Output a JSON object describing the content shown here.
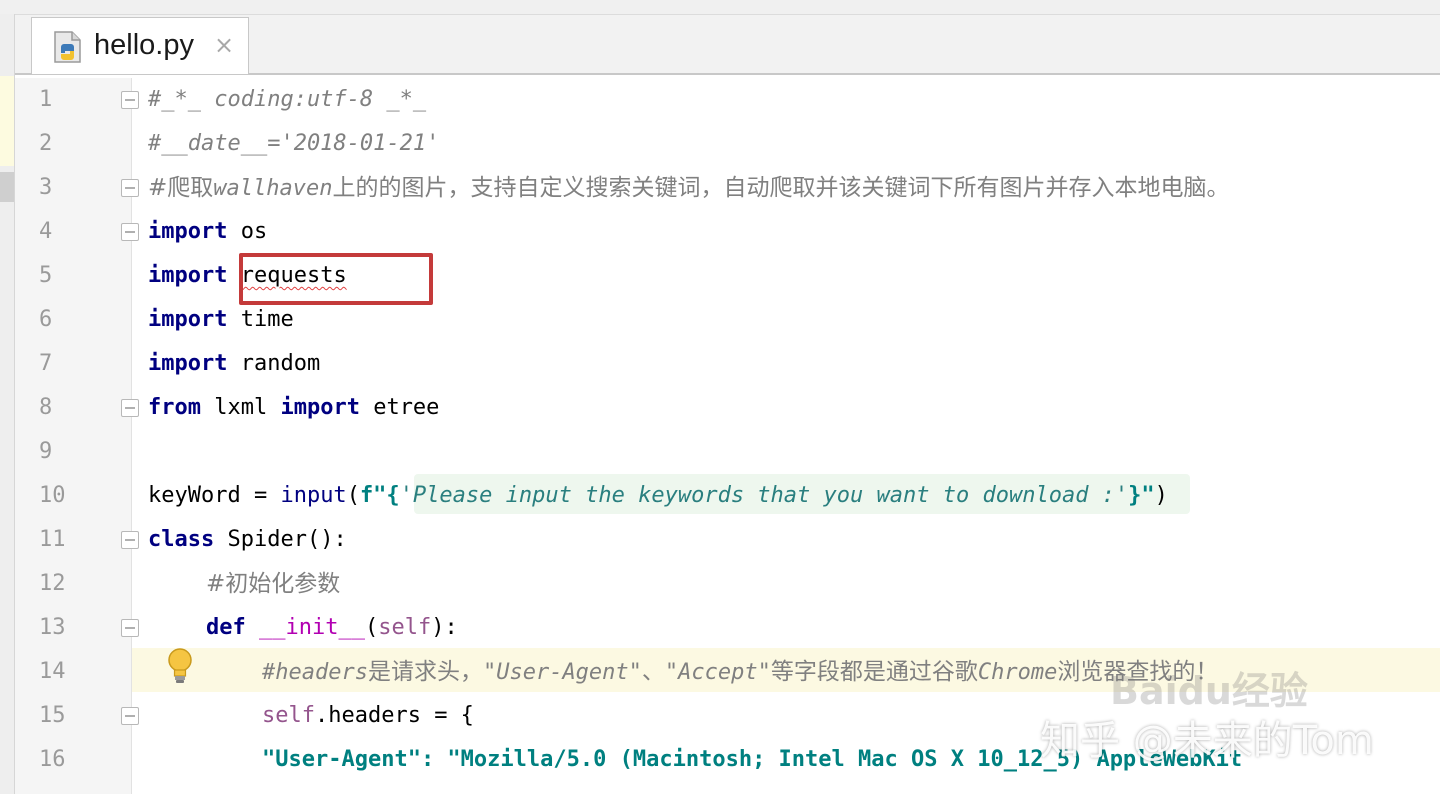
{
  "tab": {
    "label": "hello.py",
    "close": "×"
  },
  "line_numbers": [
    "1",
    "2",
    "3",
    "4",
    "5",
    "6",
    "7",
    "8",
    "9",
    "10",
    "11",
    "12",
    "13",
    "14",
    "15",
    "16"
  ],
  "code": {
    "l1": "#_*_ coding:utf-8 _*_",
    "l2": "#__date__='2018-01-21'",
    "l3_a": "#爬取",
    "l3_b": "wallhaven",
    "l3_c": "上的的图片，支持自定义搜索关键词，自动爬取并该关键词下所有图片并存入本地电脑。",
    "kw_import": "import",
    "kw_from": "from",
    "kw_class": "class",
    "kw_def": "def",
    "l4_mod": " os",
    "l5_mod": "requests",
    "l6_mod": " time",
    "l7_mod": " random",
    "l8_mod": " lxml ",
    "l8_tail": " etree",
    "l10_a": "keyWord = ",
    "l10_fn": "input",
    "l10_b": "(",
    "l10_f": "f\"{",
    "l10_str": "'Please input the keywords that you want to download :'",
    "l10_close": "}\"",
    "l10_end": ")",
    "l11_tail": " Spider():",
    "l12": "#初始化参数",
    "l13_magic": "__init__",
    "l13_a": "(",
    "l13_self": "self",
    "l13_b": "):",
    "l14_a": "#headers",
    "l14_b": "是请求头，",
    "l14_c": "\"User-Agent\"",
    "l14_d": "、",
    "l14_e": "\"Accept\"",
    "l14_f": "等字段都是通过谷歌",
    "l14_g": "Chrome",
    "l14_h": "浏览器查找的！",
    "l15_self": "self",
    "l15_tail": ".headers = {",
    "l16": "\"User-Agent\": \"Mozilla/5.0 (Macintosh; Intel Mac OS X 10_12_5) AppleWebKit"
  },
  "watermarks": {
    "baidu": "Baidu经验",
    "zhihu": "知乎 @未来的Tom"
  },
  "colors": {
    "keyword": "#000080",
    "comment": "#808080",
    "string": "#008080",
    "highlight_box": "#c43a3a",
    "current_line": "#fcf9e2"
  },
  "icons": {
    "file": "python-file-icon",
    "close": "close-icon",
    "hint": "lightbulb-icon"
  }
}
